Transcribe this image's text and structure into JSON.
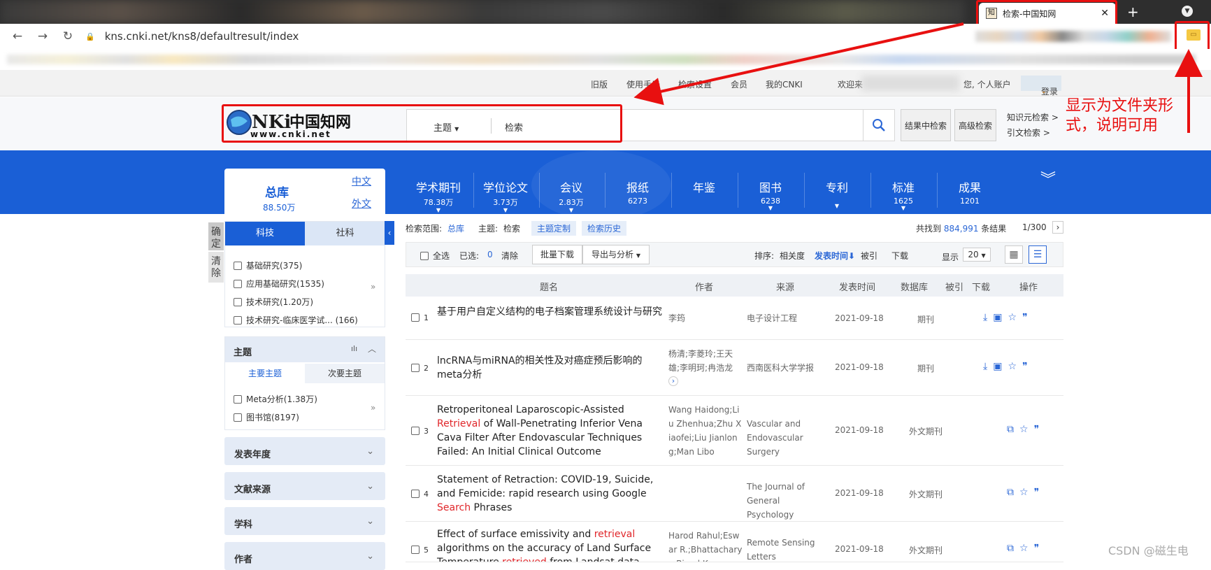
{
  "browser": {
    "tab_title": "检索-中国知网",
    "tab_favicon": "知",
    "url": "kns.cnki.net/kns8/defaultresult/index"
  },
  "topbar": {
    "items": [
      "旧版",
      "使用手册",
      "检索设置",
      "会员",
      "我的CNKI",
      "欢迎来",
      "您, 个人账户"
    ],
    "login": "登录"
  },
  "search": {
    "scope": "主题",
    "placeholder": "检索",
    "in_result": "结果中检索",
    "advanced": "高级检索",
    "knowledge": "知识元检索",
    "citation": "引文检索",
    "logo_text": "中国知网",
    "logo_url": "www.cnki.net"
  },
  "annotation": {
    "text": "显示为文件夹形式，说明可用"
  },
  "databases": [
    {
      "name": "学术期刊",
      "count": "78.38万",
      "arrow": true
    },
    {
      "name": "学位论文",
      "count": "3.73万",
      "arrow": true
    },
    {
      "name": "会议",
      "count": "2.83万",
      "arrow": true
    },
    {
      "name": "报纸",
      "count": "6273",
      "arrow": false
    },
    {
      "name": "年鉴",
      "count": "",
      "arrow": false
    },
    {
      "name": "图书",
      "count": "6238",
      "arrow": true
    },
    {
      "name": "专利",
      "count": "",
      "arrow": true
    },
    {
      "name": "标准",
      "count": "1625",
      "arrow": true
    },
    {
      "name": "成果",
      "count": "1201",
      "arrow": false
    }
  ],
  "zongku": {
    "title": "总库",
    "count": "88.50万",
    "zh": "中文",
    "en": "外文"
  },
  "sidebar": {
    "confirm": "确定",
    "clear": "清除",
    "tab_tech": "科技",
    "tab_social": "社科",
    "tech_items": [
      "基础研究(375)",
      "应用基础研究(1535)",
      "技术研究(1.20万)",
      "技术研究-临床医学试... (166)"
    ],
    "topic_title": "主题",
    "topic_tab_main": "主要主题",
    "topic_tab_sub": "次要主题",
    "topic_items": [
      "Meta分析(1.38万)",
      "图书馆(8197)"
    ],
    "collapsed": [
      "发表年度",
      "文献来源",
      "学科",
      "作者"
    ]
  },
  "results_meta": {
    "scope_label": "检索范围:",
    "scope_value": "总库",
    "topic_label": "主题:",
    "topic_value": "检索",
    "custom": "主题定制",
    "history": "检索历史",
    "found_prefix": "共找到",
    "found_count": "884,991",
    "found_suffix": "条结果",
    "page": "1/300",
    "select_all": "全选",
    "selected_label": "已选:",
    "selected_count": "0",
    "clear": "清除",
    "batch_download": "批量下载",
    "export": "导出与分析",
    "sort_label": "排序:",
    "sort_relevance": "相关度",
    "sort_date": "发表时间",
    "sort_cited": "被引",
    "sort_download": "下载",
    "show_label": "显示",
    "show_count": "20"
  },
  "table_headers": [
    "题名",
    "作者",
    "来源",
    "发表时间",
    "数据库",
    "被引",
    "下载",
    "操作"
  ],
  "rows": [
    {
      "num": "1",
      "title": "基于用户自定义结构的电子档案管理系统设计与研究",
      "author": "李筠",
      "source": "电子设计工程",
      "date": "2021-09-18",
      "db": "期刊"
    },
    {
      "num": "2",
      "title": "lncRNA与miRNA的相关性及对癌症预后影响的meta分析",
      "author": "杨清;李菱玲;王天雄;李明珂;冉浩龙",
      "source": "西南医科大学学报",
      "date": "2021-09-18",
      "db": "期刊"
    },
    {
      "num": "3",
      "title": "Retroperitoneal Laparoscopic-Assisted Retrieval of Wall-Penetrating Inferior Vena Cava Filter After Endovascular Techniques Failed: An Initial Clinical Outcome",
      "author": "Wang Haidong;Liu Zhenhua;Zhu Xiaofei;Liu Jianlong;Man Libo",
      "source": "Vascular and Endovascular Surgery",
      "date": "2021-09-18",
      "db": "外文期刊"
    },
    {
      "num": "4",
      "title": "Statement of Retraction: COVID-19, Suicide, and Femicide: rapid research using Google Search Phrases",
      "author": "",
      "source": "The Journal of General Psychology",
      "date": "2021-09-18",
      "db": "外文期刊"
    },
    {
      "num": "5",
      "title": "Effect of surface emissivity and retrieval algorithms on the accuracy of Land Surface Temperature retrieved from Landsat data",
      "author": "Harod Rahul;Eswar R.;Bhattacharya Bimal K.",
      "source": "Remote Sensing Letters",
      "date": "2021-09-18",
      "db": "外文期刊"
    }
  ],
  "watermark": "CSDN @磁生电"
}
